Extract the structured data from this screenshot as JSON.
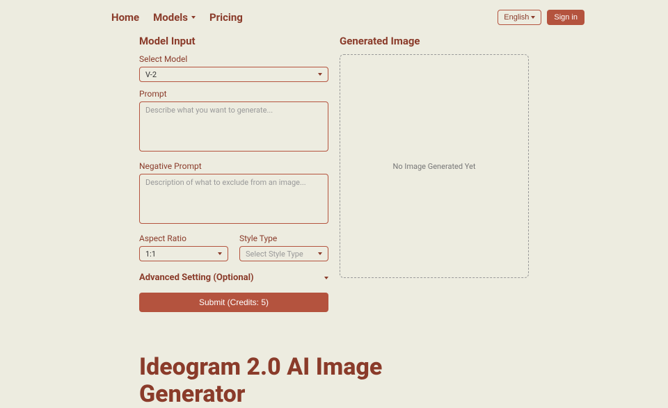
{
  "nav": {
    "home": "Home",
    "models": "Models",
    "pricing": "Pricing"
  },
  "topbar": {
    "language": "English",
    "signin": "Sign in"
  },
  "form": {
    "sectionTitle": "Model Input",
    "selectModelLabel": "Select Model",
    "selectModelValue": "V-2",
    "promptLabel": "Prompt",
    "promptPlaceholder": "Describe what you want to generate...",
    "negPromptLabel": "Negative Prompt",
    "negPromptPlaceholder": "Description of what to exclude from an image...",
    "aspectRatioLabel": "Aspect Ratio",
    "aspectRatioValue": "1:1",
    "styleTypeLabel": "Style Type",
    "styleTypePlaceholder": "Select Style Type",
    "advancedLabel": "Advanced Setting (Optional)",
    "submitLabel": "Submit (Credits: 5)"
  },
  "output": {
    "sectionTitle": "Generated Image",
    "emptyText": "No Image Generated Yet"
  },
  "hero": {
    "title": "Ideogram 2.0 AI Image Generator"
  }
}
